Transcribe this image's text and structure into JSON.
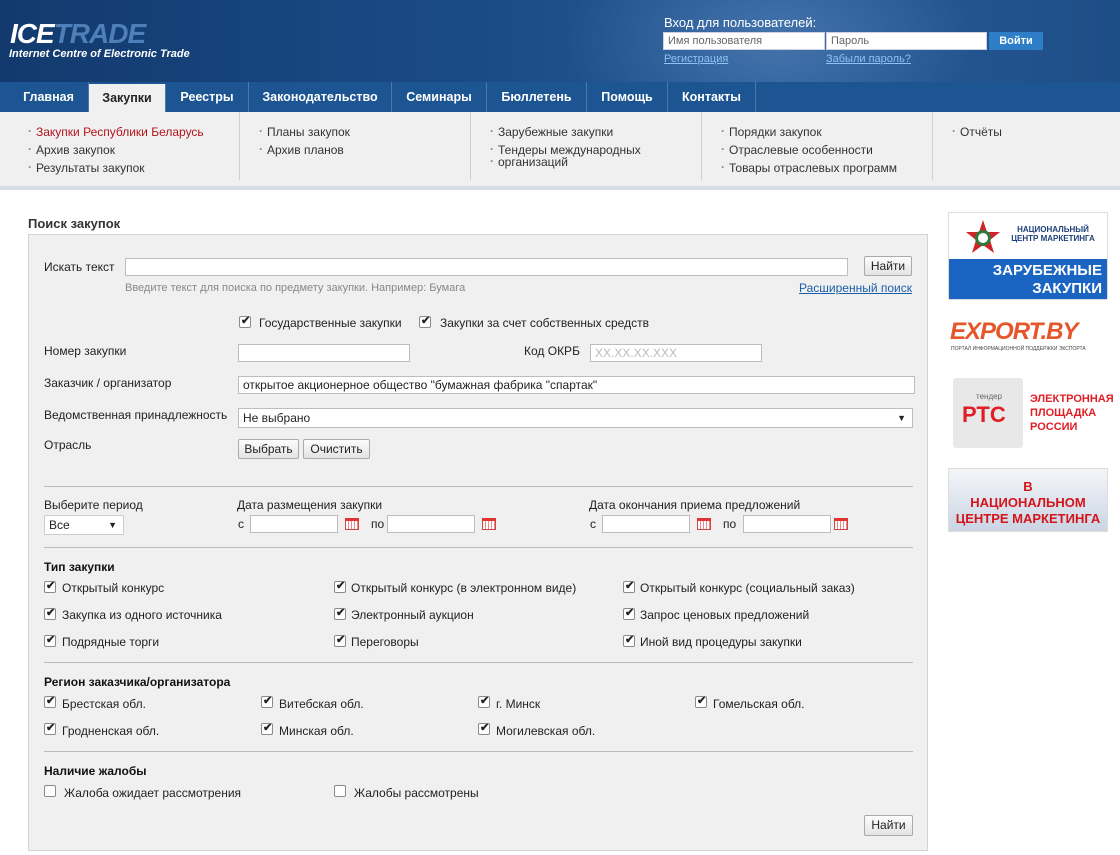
{
  "header": {
    "logo_ice": "ICE",
    "logo_trade": "TRADE",
    "logo_sub": "Internet Centre of Electronic Trade",
    "login_title": "Вход для пользователей:",
    "username_placeholder": "Имя пользователя",
    "password_placeholder": "Пароль",
    "login_button": "Войти",
    "register_link": "Регистрация",
    "forgot_link": "Забыли пароль?"
  },
  "nav": {
    "items": [
      "Главная",
      "Закупки",
      "Реестры",
      "Законодательство",
      "Семинары",
      "Бюллетень",
      "Помощь",
      "Контакты"
    ],
    "active": "Закупки"
  },
  "subnav": {
    "col1": [
      "Закупки Республики Беларусь",
      "Архив закупок",
      "Результаты закупок"
    ],
    "col2": [
      "Планы закупок",
      "Архив планов"
    ],
    "col3": [
      "Зарубежные закупки",
      "Тендеры международных",
      "организаций"
    ],
    "col4": [
      "Порядки закупок",
      "Отраслевые особенности",
      "Товары отраслевых программ"
    ],
    "col5": [
      "Отчёты"
    ]
  },
  "search": {
    "title": "Поиск закупок",
    "text_label": "Искать текст",
    "text_value": "",
    "find_button": "Найти",
    "hint": "Введите текст для поиска по предмету закупки. Например: Бумага",
    "advanced_link": "Расширенный поиск",
    "cb_state": "Государственные закупки",
    "cb_own": "Закупки за счет собственных средств",
    "number_label": "Номер закупки",
    "number_value": "",
    "okrb_label": "Код ОКРБ",
    "okrb_placeholder": "XX.XX.XX.XXX",
    "customer_label": "Заказчик / организатор",
    "customer_value": "открытое акционерное общество \"бумажная фабрика \"спартак\"",
    "dept_label": "Ведомственная принадлежность",
    "dept_value": "Не выбрано",
    "industry_label": "Отрасль",
    "select_button": "Выбрать",
    "clear_button": "Очистить"
  },
  "period": {
    "label": "Выберите период",
    "value": "Все",
    "placement_label": "Дата размещения закупки",
    "deadline_label": "Дата окончания приема предложений",
    "from": "с",
    "to": "по"
  },
  "types": {
    "title": "Тип закупки",
    "items": [
      "Открытый конкурс",
      "Открытый конкурс (в электронном виде)",
      "Открытый конкурс (социальный заказ)",
      "Закупка из одного источника",
      "Электронный аукцион",
      "Запрос ценовых предложений",
      "Подрядные торги",
      "Переговоры",
      "Иной вид процедуры закупки"
    ]
  },
  "regions": {
    "title": "Регион заказчика/организатора",
    "items": [
      "Брестская обл.",
      "Витебская обл.",
      "г. Минск",
      "Гомельская обл.",
      "Гродненская обл.",
      "Минская обл.",
      "Могилевская обл."
    ]
  },
  "complaints": {
    "title": "Наличие жалобы",
    "items": [
      "Жалоба ожидает рассмотрения",
      "Жалобы рассмотрены"
    ]
  },
  "submit_button": "Найти",
  "banners": {
    "b1_top": "НАЦИОНАЛЬНЫЙ ЦЕНТР МАРКЕТИНГА",
    "b1_line1": "ЗАРУБЕЖНЫЕ",
    "b1_line2": "ЗАКУПКИ",
    "b2_title": "EXPORT.BY",
    "b2_sub": "ПОРТАЛ ИНФОРМАЦИОННОЙ ПОДДЕРЖКИ ЭКСПОРТА",
    "b3_tender": "тендер",
    "b3_rts": "РТС",
    "b3_l1": "ЭЛЕКТРОННАЯ",
    "b3_l2": "ПЛОЩАДКА",
    "b3_l3": "РОССИИ",
    "b4_l1": "В",
    "b4_l2": "НАЦИОНАЛЬНОМ",
    "b4_l3": "ЦЕНТРЕ МАРКЕТИНГА"
  }
}
